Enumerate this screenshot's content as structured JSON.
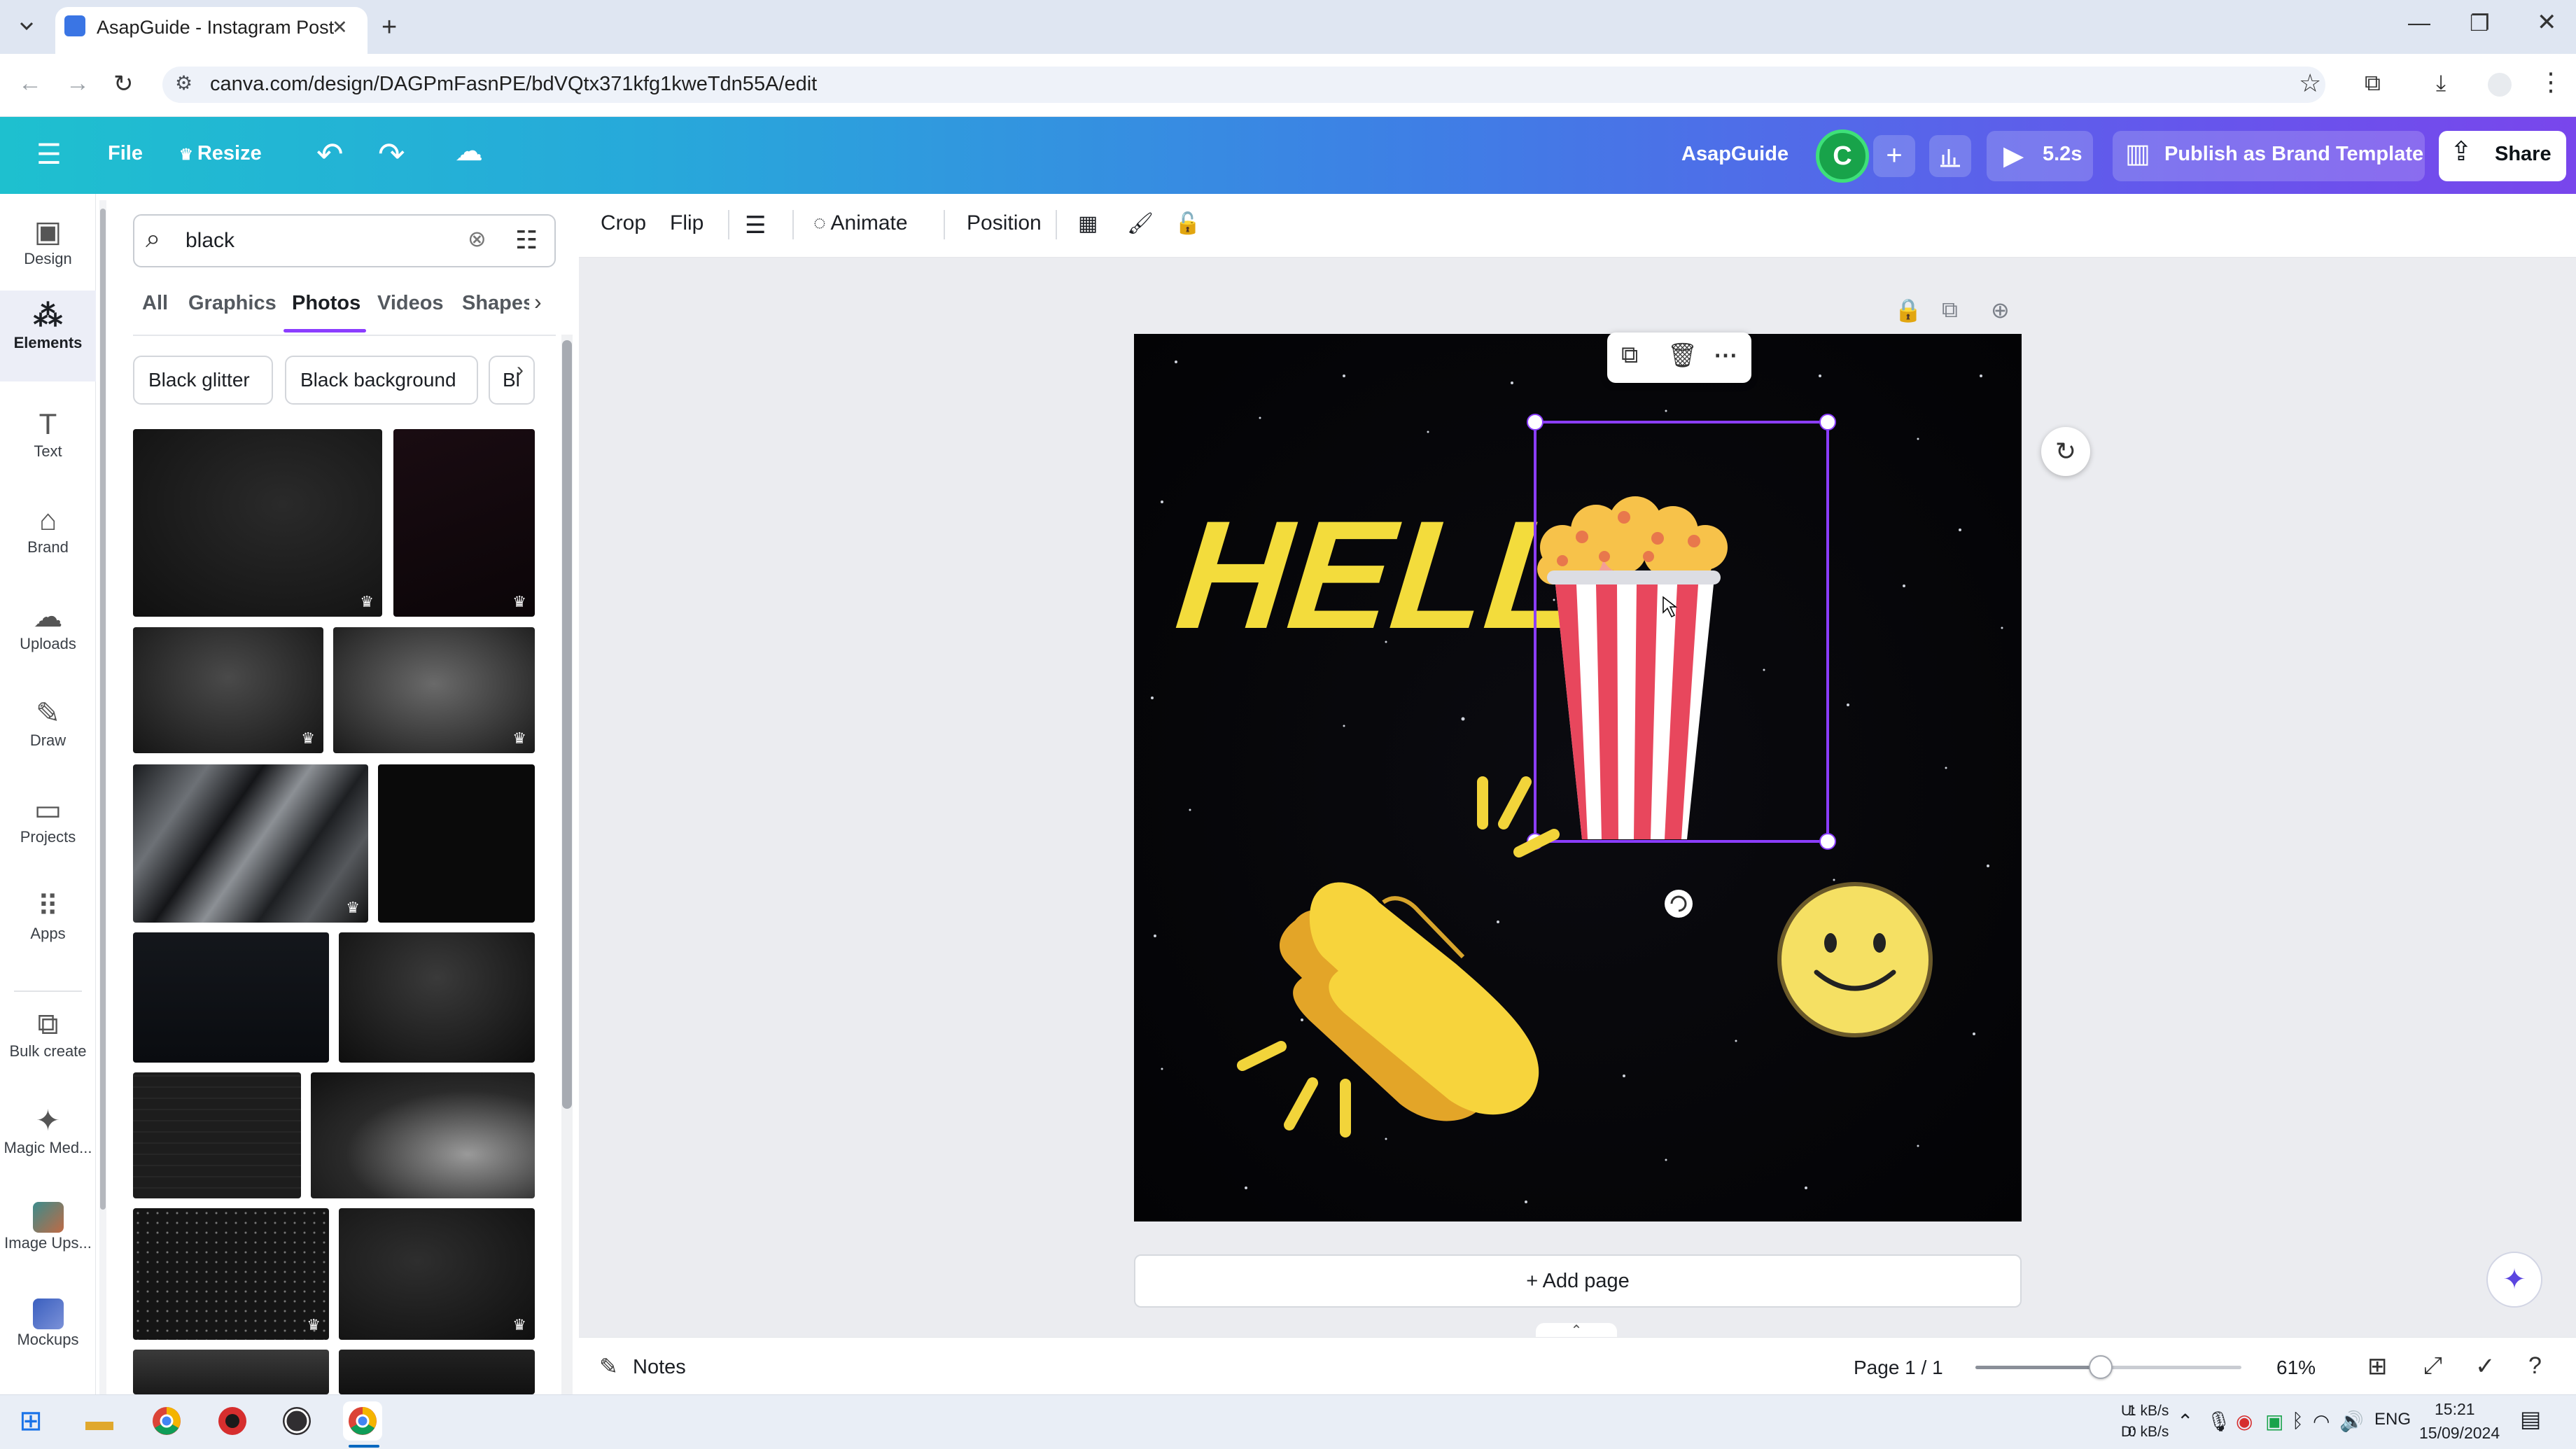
{
  "browser": {
    "tab_title": "AsapGuide - Instagram Post",
    "tab_close": "✕",
    "new_tab": "+",
    "url": "canva.com/design/DAGPmFasnPE/bdVQtx371kfg1kweTdn55A/edit",
    "window_controls": {
      "minimize": "—",
      "maximize": "❐",
      "close": "✕"
    }
  },
  "header": {
    "menu_icon": "☰",
    "file_label": "File",
    "resize_label": "Resize",
    "undo_icon": "↶",
    "redo_icon": "↷",
    "cloud_icon": "☁",
    "document_name": "AsapGuide",
    "avatar_initial": "C",
    "add_icon": "+",
    "insights_icon": "📊",
    "present_icon": "▶",
    "present_time": "5.2s",
    "publish_label": "Publish as Brand Template",
    "share_label": "Share"
  },
  "rail": {
    "design": "Design",
    "elements": "Elements",
    "text": "Text",
    "brand": "Brand",
    "uploads": "Uploads",
    "draw": "Draw",
    "projects": "Projects",
    "apps": "Apps",
    "bulk_create": "Bulk create",
    "magic_media": "Magic Med...",
    "image_upscaler": "Image Ups...",
    "mockups": "Mockups"
  },
  "panel": {
    "search_value": "black",
    "tabs": {
      "all": "All",
      "graphics": "Graphics",
      "photos": "Photos",
      "videos": "Videos",
      "shapes": "Shapes"
    },
    "chips": {
      "chip1": "Black glitter",
      "chip2": "Black background",
      "chip3": "Bl"
    }
  },
  "toolbar": {
    "crop": "Crop",
    "flip": "Flip",
    "animate": "Animate",
    "position": "Position"
  },
  "canvas": {
    "hello_text": "HELLO",
    "add_page": "+ Add page"
  },
  "status": {
    "notes": "Notes",
    "page_counter": "Page 1 / 1",
    "zoom": "61%",
    "zoom_level": 0.47
  },
  "taskbar": {
    "net_up_label": "U:",
    "net_down_label": "D:",
    "net_up": "1 kB/s",
    "net_down": "0 kB/s",
    "language": "ENG",
    "time": "15:21",
    "date": "15/09/2024"
  },
  "colors": {
    "accent_purple": "#8b3dff",
    "canvas_bg": "#050508",
    "hello_yellow": "#f3dc3c",
    "popcorn_red": "#e8475d",
    "smiley_yellow": "#f5e063"
  }
}
